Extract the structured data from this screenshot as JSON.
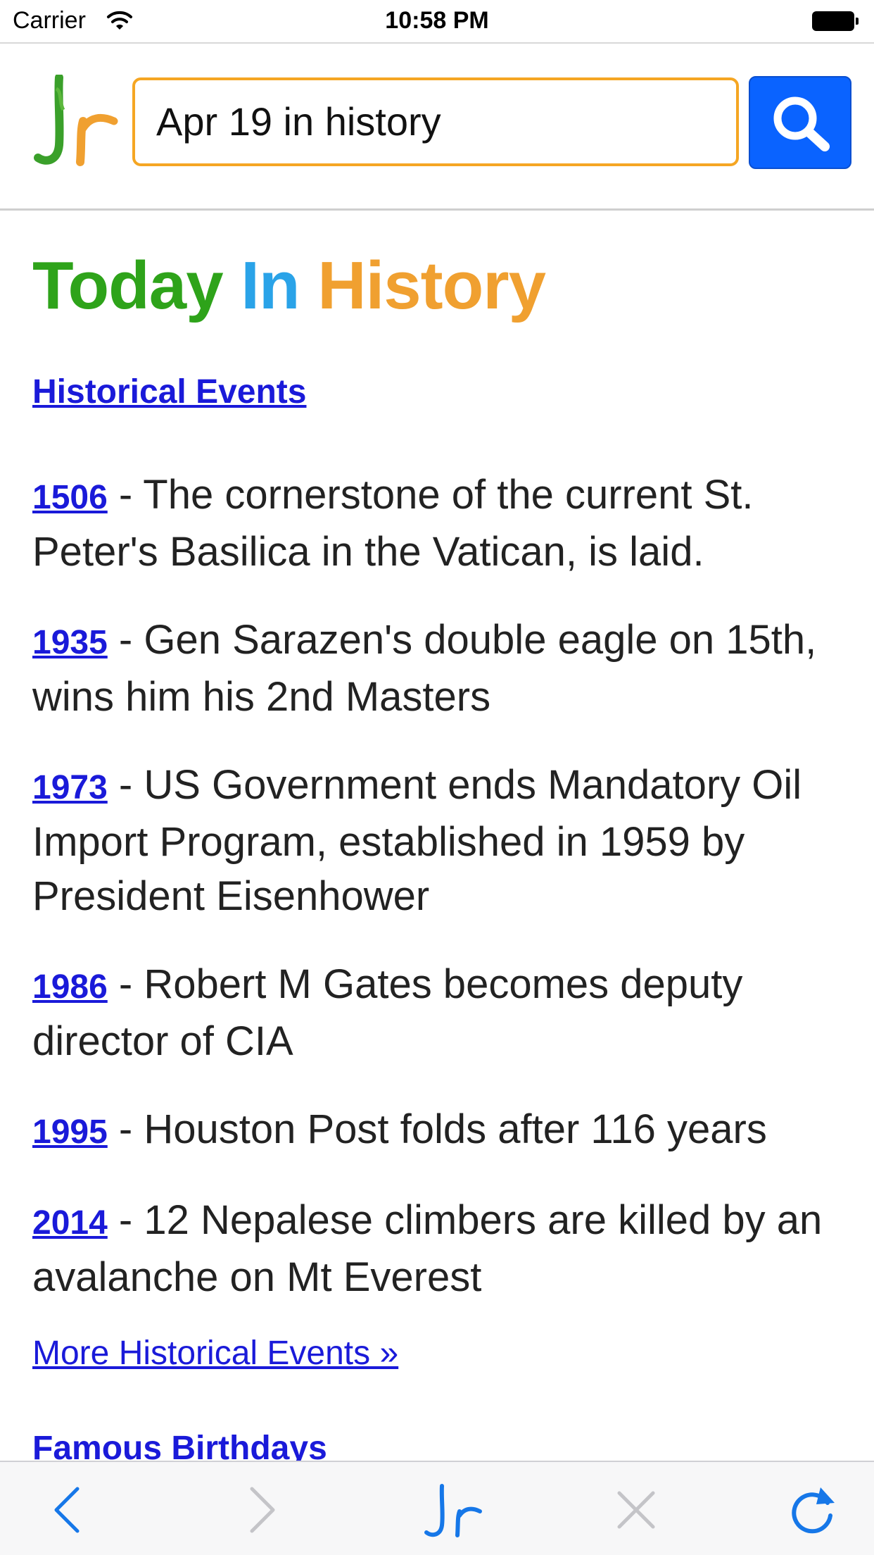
{
  "status_bar": {
    "carrier": "Carrier",
    "time": "10:58 PM"
  },
  "header": {
    "logo_icon": "jr-logo-icon",
    "search": {
      "value": "Apr 19 in history",
      "border_color": "#f5a623"
    },
    "search_button_icon": "search-icon",
    "search_button_color": "#0a63ff"
  },
  "page": {
    "title_parts": [
      "Today",
      "In",
      "History"
    ],
    "title_colors": [
      "#2ea31a",
      "#2aa3e8",
      "#f0a030"
    ],
    "section_link": "Historical Events",
    "events": [
      {
        "year": "1506",
        "text": " - The cornerstone of the current St. Peter's Basilica in the Vatican, is laid."
      },
      {
        "year": "1935",
        "text": " - Gen Sarazen's double eagle on 15th, wins him his 2nd Masters"
      },
      {
        "year": "1973",
        "text": " - US Government ends Mandatory Oil Import Program, established in 1959 by President Eisenhower"
      },
      {
        "year": "1986",
        "text": " - Robert M Gates becomes deputy director of CIA"
      },
      {
        "year": "1995",
        "text": " - Houston Post folds after 116 years"
      },
      {
        "year": "2014",
        "text": " - 12 Nepalese climbers are killed by an avalanche on Mt Everest"
      }
    ],
    "more_link": "More Historical Events »",
    "next_section": "Famous Birthdays",
    "link_color": "#1a1ad9"
  },
  "toolbar": {
    "buttons": [
      "back-icon",
      "forward-icon",
      "jr-home-icon",
      "stop-icon",
      "reload-icon"
    ]
  }
}
